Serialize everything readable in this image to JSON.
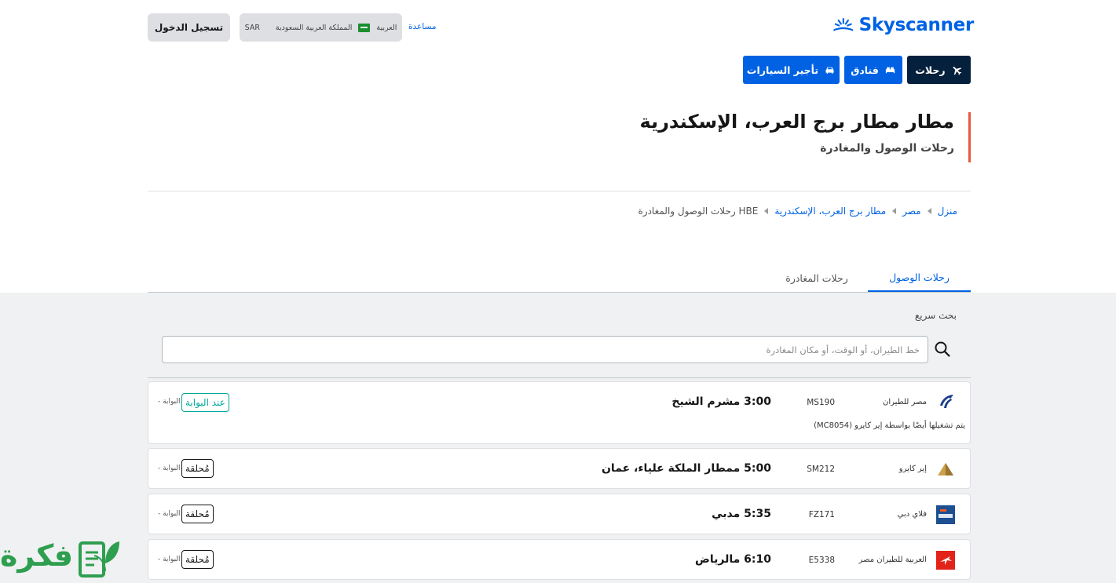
{
  "header": {
    "logo_text": "Skyscanner",
    "login_label": "تسجيل الدخول",
    "locale": {
      "language": "العربية",
      "country": "المملكة العربية السعودية",
      "currency": "SAR"
    },
    "help_label": "مساعدة"
  },
  "nav": {
    "flights": "رحلات",
    "hotels": "فنادق",
    "cars": "تأجير السيارات"
  },
  "page": {
    "title": "مطار مطار برج العرب، الإسكندرية",
    "subtitle": "رحلات الوصول والمغادرة"
  },
  "breadcrumb": {
    "items": [
      "منزل",
      "مصر",
      "مطار برج العرب، الإسكندرية"
    ],
    "current": "HBE رحلات الوصول والمغادرة"
  },
  "tabs": {
    "arrivals": "رحلات الوصول",
    "departures": "رحلات المغادرة"
  },
  "search": {
    "label": "بحث سريع",
    "placeholder": "خط الطيران، أو الوقت، أو مكان المغادرة"
  },
  "flights": [
    {
      "airline": "مصر للطيران",
      "flight_no": "MS190",
      "time_dest": "3:00 مشرم الشيخ",
      "status": "عند البوابة",
      "gate": "البوابة -",
      "operated_by": "يتم تشغيلها أيضًا بواسطة إير كايرو (MC8054)"
    },
    {
      "airline": "إير كايرو",
      "flight_no": "SM212",
      "time_dest": "5:00 ممطار الملكة علياء، عمان",
      "status": "مُحلقة",
      "gate": "البوابة -"
    },
    {
      "airline": "فلاي دبي",
      "flight_no": "FZ171",
      "time_dest": "5:35 مدبي",
      "status": "مُحلقة",
      "gate": "البوابة -"
    },
    {
      "airline": "العربية للطيران مصر",
      "flight_no": "E5338",
      "time_dest": "6:10 مالرياض",
      "status": "مُحلقة",
      "gate": "البوابة -"
    }
  ],
  "watermark": {
    "text": "فكرة"
  },
  "colors": {
    "brand": "#0062e3",
    "nav_dark": "#05203c",
    "accent_bar": "#e7593f",
    "status_gate": "#00a698",
    "watermark": "#2e9e4f"
  }
}
